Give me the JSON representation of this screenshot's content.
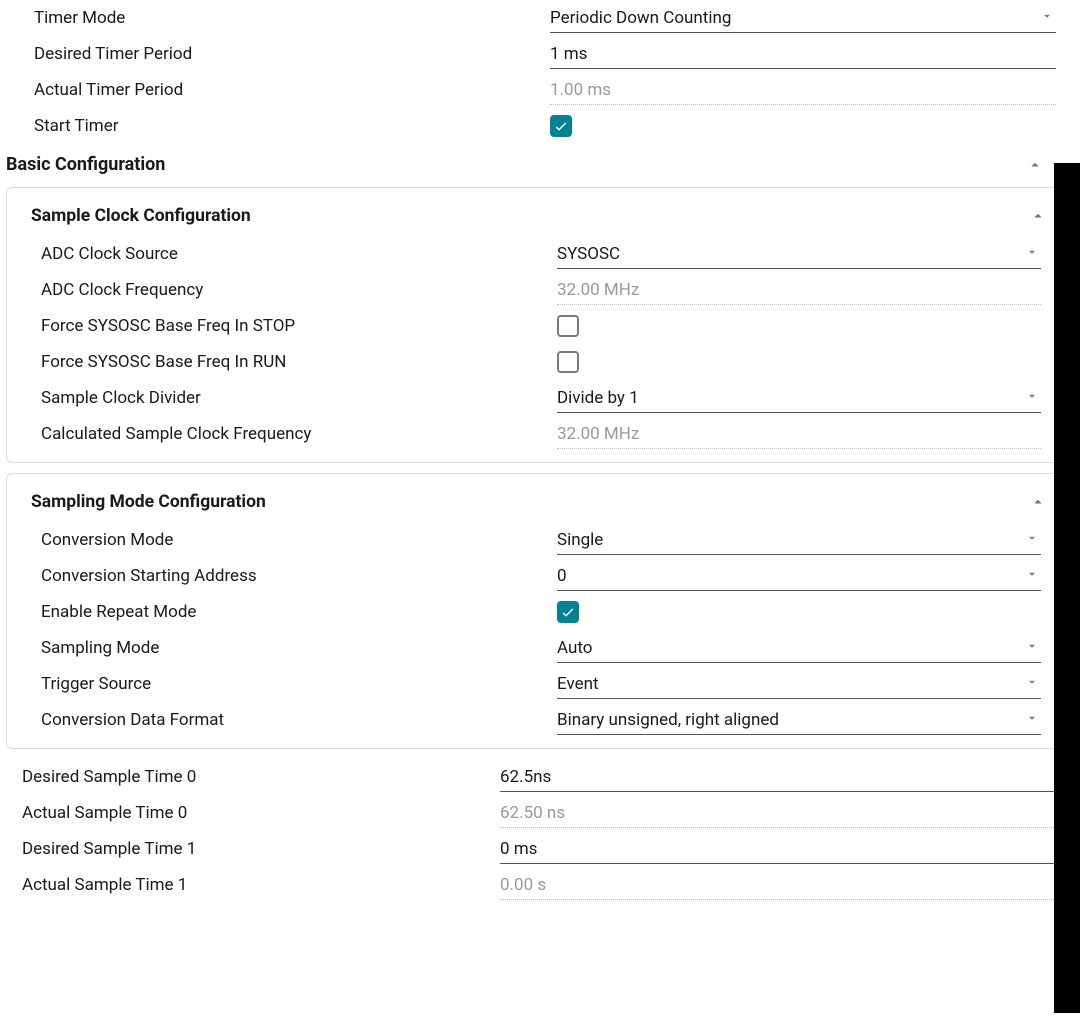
{
  "timer": {
    "mode_label": "Timer Mode",
    "mode_value": "Periodic Down Counting",
    "desired_label": "Desired Timer Period",
    "desired_value": "1 ms",
    "actual_label": "Actual Timer Period",
    "actual_value": "1.00 ms",
    "start_label": "Start Timer",
    "start_checked": true
  },
  "basic_section_title": "Basic Configuration",
  "sample_clock": {
    "title": "Sample Clock Configuration",
    "adc_src_label": "ADC Clock Source",
    "adc_src_value": "SYSOSC",
    "adc_freq_label": "ADC Clock Frequency",
    "adc_freq_value": "32.00 MHz",
    "force_stop_label": "Force SYSOSC Base Freq In STOP",
    "force_stop_checked": false,
    "force_run_label": "Force SYSOSC Base Freq In RUN",
    "force_run_checked": false,
    "divider_label": "Sample Clock Divider",
    "divider_value": "Divide by 1",
    "calc_label": "Calculated Sample Clock Frequency",
    "calc_value": "32.00 MHz"
  },
  "sampling_mode": {
    "title": "Sampling Mode Configuration",
    "conv_mode_label": "Conversion Mode",
    "conv_mode_value": "Single",
    "start_addr_label": "Conversion Starting Address",
    "start_addr_value": "0",
    "repeat_label": "Enable Repeat Mode",
    "repeat_checked": true,
    "samp_mode_label": "Sampling Mode",
    "samp_mode_value": "Auto",
    "trigger_label": "Trigger Source",
    "trigger_value": "Event",
    "format_label": "Conversion Data Format",
    "format_value": "Binary unsigned, right aligned"
  },
  "sample_times": {
    "desired0_label": "Desired Sample Time 0",
    "desired0_value": "62.5ns",
    "actual0_label": "Actual Sample Time 0",
    "actual0_value": "62.50 ns",
    "desired1_label": "Desired Sample Time 1",
    "desired1_value": "0 ms",
    "actual1_label": "Actual Sample Time 1",
    "actual1_value": "0.00 s"
  }
}
